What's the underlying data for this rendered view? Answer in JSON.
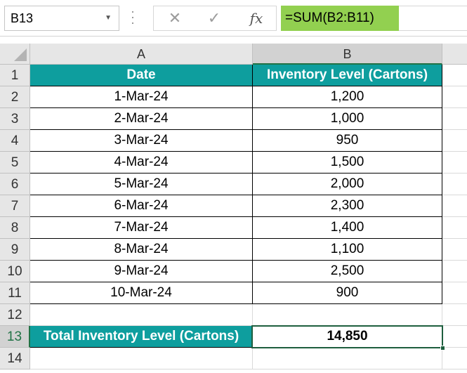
{
  "formula_bar": {
    "name_box": "B13",
    "cancel_glyph": "✕",
    "enter_glyph": "✓",
    "fx_label": "fx",
    "formula": "=SUM(B2:B11)"
  },
  "columns": [
    "A",
    "B"
  ],
  "rows": [
    "1",
    "2",
    "3",
    "4",
    "5",
    "6",
    "7",
    "8",
    "9",
    "10",
    "11",
    "12",
    "13",
    "14"
  ],
  "header": {
    "date": "Date",
    "inventory": "Inventory Level (Cartons)"
  },
  "data_rows": [
    {
      "date": "1-Mar-24",
      "value": "1,200"
    },
    {
      "date": "2-Mar-24",
      "value": "1,000"
    },
    {
      "date": "3-Mar-24",
      "value": "950"
    },
    {
      "date": "4-Mar-24",
      "value": "1,500"
    },
    {
      "date": "5-Mar-24",
      "value": "2,000"
    },
    {
      "date": "6-Mar-24",
      "value": "2,300"
    },
    {
      "date": "7-Mar-24",
      "value": "1,400"
    },
    {
      "date": "8-Mar-24",
      "value": "1,100"
    },
    {
      "date": "9-Mar-24",
      "value": "2,500"
    },
    {
      "date": "10-Mar-24",
      "value": "900"
    }
  ],
  "total": {
    "label": "Total Inventory Level (Cartons)",
    "value": "14,850"
  },
  "colors": {
    "teal_header": "#0e9e9e",
    "formula_highlight": "#92d050",
    "selection": "#217346"
  },
  "icons": [
    "chevron-down-icon",
    "cancel-icon",
    "enter-icon",
    "fx-icon",
    "select-all-icon"
  ]
}
